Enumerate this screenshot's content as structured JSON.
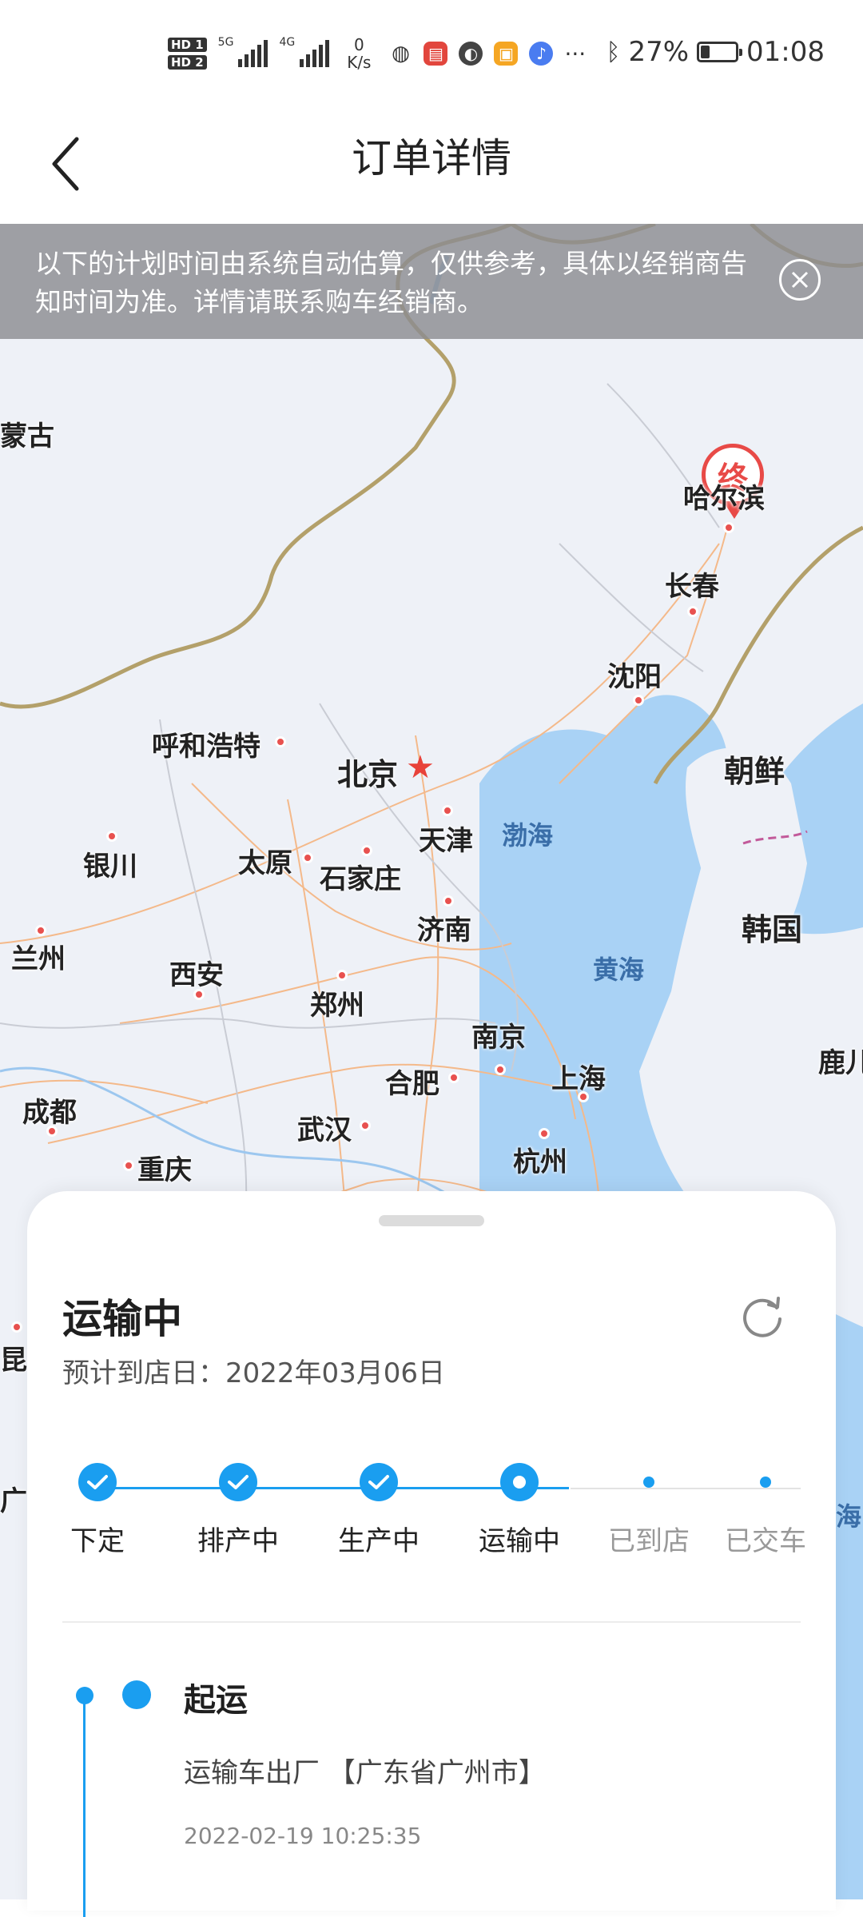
{
  "status_bar": {
    "hd1": "HD 1",
    "hd2": "HD 2",
    "net1": "5G",
    "net2": "4G",
    "speed_value": "0",
    "speed_unit": "K/s",
    "more": "···",
    "battery_percent": "27%",
    "battery_level": 0.27,
    "time": "01:08"
  },
  "header": {
    "title": "订单详情"
  },
  "notice": {
    "text": "以下的计划时间由系统自动估算，仅供参考，具体以经销商告知时间为准。详情请联系购车经销商。"
  },
  "map": {
    "end_marker": "终",
    "labels": {
      "neimenggu": "蒙古",
      "haerbin": "哈尔滨",
      "changchun": "长春",
      "shenyang": "沈阳",
      "huhehaote": "呼和浩特",
      "beijing": "北京",
      "chaoxian": "朝鲜",
      "tianjin": "天津",
      "bohai": "渤海",
      "yinchuan": "银川",
      "taiyuan": "太原",
      "shijiazhuang": "石家庄",
      "jinan": "济南",
      "hanguo": "韩国",
      "lanzhou": "兰州",
      "xian": "西安",
      "huanghai": "黄海",
      "zhengzhou": "郑州",
      "nanjing": "南京",
      "shanghai": "上海",
      "luer": "鹿儿",
      "hefei": "合肥",
      "chengdu": "成都",
      "wuhan": "武汉",
      "hangzhou": "杭州",
      "chongqing": "重庆",
      "kunming": "昆明",
      "guangxi": "广",
      "dongjiang": "海"
    }
  },
  "card": {
    "status_title": "运输中",
    "eta_label": "预计到店日：",
    "eta_date": "2022年03月06日",
    "steps": [
      {
        "label": "下定",
        "state": "done"
      },
      {
        "label": "排产中",
        "state": "done"
      },
      {
        "label": "生产中",
        "state": "done"
      },
      {
        "label": "运输中",
        "state": "current"
      },
      {
        "label": "已到店",
        "state": "pending"
      },
      {
        "label": "已交车",
        "state": "pending"
      }
    ],
    "timeline": {
      "title": "起运",
      "desc": "运输车出厂 【广东省广州市】",
      "time": "2022-02-19 10:25:35"
    }
  },
  "colors": {
    "accent": "#1a9ef0",
    "map_marker": "#e84a47",
    "notice_bg": "#8c8c91"
  }
}
